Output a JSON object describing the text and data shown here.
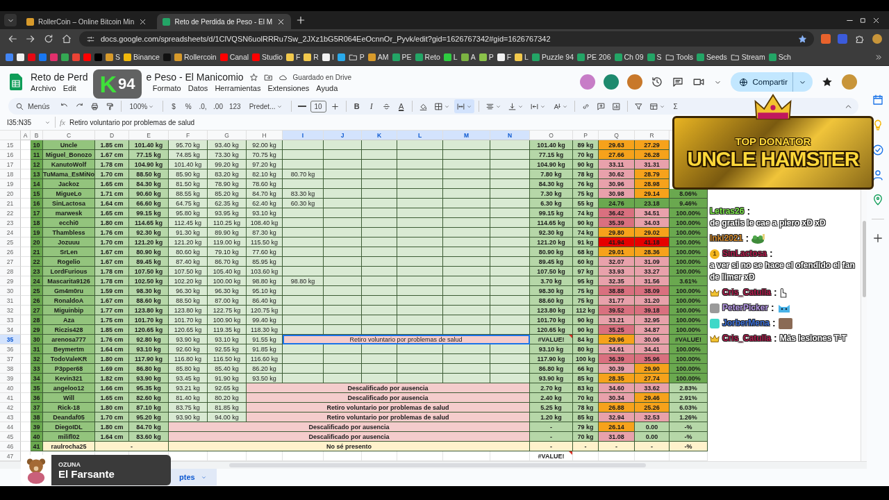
{
  "browser": {
    "tabs": [
      {
        "title": "RollerCoin – Online Bitcoin Min",
        "selected": false,
        "color": "#d79a2b"
      },
      {
        "title": "Reto de Perdida de Peso - El M",
        "selected": true,
        "color": "#23a566"
      }
    ],
    "url": "docs.google.com/spreadsheets/d/1ClVQSN6uolRRRu7Sw_2JXz1bG5R064EeOcnnOr_Pyvk/edit?gid=1626767342#gid=1626767342",
    "bookmarks": [
      {
        "kind": "site",
        "color": "#4285f4"
      },
      {
        "kind": "site",
        "color": "#f1f1f1"
      },
      {
        "kind": "site",
        "color": "#e50914"
      },
      {
        "kind": "site",
        "color": "#1877f2"
      },
      {
        "kind": "site",
        "color": "#e1306c"
      },
      {
        "kind": "site",
        "color": "#34a853"
      },
      {
        "kind": "site",
        "color": "#ea4335"
      },
      {
        "kind": "site",
        "color": "#ff0000"
      },
      {
        "kind": "site",
        "color": "#000000"
      },
      {
        "kind": "site",
        "label": "S",
        "color": "#d79a2b"
      },
      {
        "kind": "site",
        "label": "Binance",
        "color": "#f0b90b"
      },
      {
        "kind": "site",
        "color": "#111111"
      },
      {
        "kind": "site",
        "label": "Rollercoin",
        "color": "#d79a2b"
      },
      {
        "kind": "site",
        "label": "Canal",
        "color": "#ff0000"
      },
      {
        "kind": "site",
        "label": "Studio",
        "color": "#ff0000"
      },
      {
        "kind": "site",
        "label": "F",
        "color": "#f2c94c"
      },
      {
        "kind": "site",
        "label": "R",
        "color": "#f2c94c"
      },
      {
        "kind": "site",
        "label": "I",
        "color": "#f1f1f1"
      },
      {
        "kind": "site",
        "color": "#29a9eb"
      },
      {
        "kind": "folder",
        "label": "P"
      },
      {
        "kind": "site",
        "label": "AM",
        "color": "#d79a2b"
      },
      {
        "kind": "site",
        "label": "PE",
        "color": "#23a566"
      },
      {
        "kind": "site",
        "label": "Reto",
        "color": "#23a566"
      },
      {
        "kind": "site",
        "label": "L",
        "color": "#2ecc40"
      },
      {
        "kind": "site",
        "label": "A",
        "color": "#7cb342"
      },
      {
        "kind": "site",
        "label": "P",
        "color": "#8bc34a"
      },
      {
        "kind": "site",
        "label": "F",
        "color": "#f1f1f1"
      },
      {
        "kind": "site",
        "label": "L",
        "color": "#f2c94c"
      },
      {
        "kind": "site",
        "label": "Puzzle 94",
        "color": "#23a566"
      },
      {
        "kind": "site",
        "label": "PE 206",
        "color": "#23a566"
      },
      {
        "kind": "site",
        "label": "Ch 09",
        "color": "#23a566"
      },
      {
        "kind": "site",
        "label": "S",
        "color": "#23a566"
      },
      {
        "kind": "folder",
        "label": "Tools"
      },
      {
        "kind": "site",
        "label": "Seeds",
        "color": "#23a566"
      },
      {
        "kind": "folder",
        "label": "Stream"
      },
      {
        "kind": "site",
        "label": "Sch",
        "color": "#23a566"
      }
    ]
  },
  "doc": {
    "title_parts": [
      "Reto de Perd",
      "e Peso - El Manicomio"
    ],
    "save_status": "Guardado en Drive",
    "menus": [
      "Archivo",
      "Edit",
      "Formato",
      "Datos",
      "Herramientas",
      "Extensiones",
      "Ayuda"
    ],
    "share_label": "Compartir"
  },
  "toolbar": [
    {
      "kind": "search",
      "label": "Menús",
      "active": false
    },
    {
      "kind": "undo",
      "active": false
    },
    {
      "kind": "redo",
      "active": false
    },
    {
      "kind": "print",
      "active": false
    },
    {
      "kind": "paint",
      "active": false
    },
    {
      "kind": "zoom",
      "label": "100%",
      "active": false
    },
    {
      "kind": "text",
      "label": "$",
      "active": false
    },
    {
      "kind": "text",
      "label": "%",
      "active": false
    },
    {
      "kind": "text",
      "label": ".0,",
      "active": false
    },
    {
      "kind": "text",
      "label": ".00",
      "active": false
    },
    {
      "kind": "text",
      "label": "123",
      "active": false
    },
    {
      "kind": "select",
      "label": "Predet...",
      "active": false
    },
    {
      "kind": "minus",
      "active": false
    },
    {
      "kind": "field",
      "label": "10",
      "active": false
    },
    {
      "kind": "plus",
      "active": false
    },
    {
      "kind": "bold",
      "label": "B",
      "active": false
    },
    {
      "kind": "italic",
      "label": "I",
      "active": false
    },
    {
      "kind": "strike",
      "active": false
    },
    {
      "kind": "textcolor",
      "label": "A",
      "active": false
    },
    {
      "kind": "fill",
      "active": false
    },
    {
      "kind": "borders",
      "active": false
    },
    {
      "kind": "merge",
      "active": true
    },
    {
      "kind": "align",
      "active": false
    },
    {
      "kind": "valign",
      "active": false
    },
    {
      "kind": "wrap",
      "active": false
    },
    {
      "kind": "rotate",
      "active": false
    },
    {
      "kind": "link",
      "active": false
    },
    {
      "kind": "comment",
      "active": false
    },
    {
      "kind": "chart",
      "active": false
    },
    {
      "kind": "filter",
      "active": false
    },
    {
      "kind": "table",
      "active": false
    },
    {
      "kind": "text",
      "label": "Σ",
      "active": false
    }
  ],
  "formula_bar": {
    "range": "I35:N35",
    "fx": "fx",
    "content": "Retiro voluntario por problemas de salud"
  },
  "sheet": {
    "columns": [
      {
        "letter": "A",
        "selected": false
      },
      {
        "letter": "B",
        "selected": false
      },
      {
        "letter": "C",
        "selected": false
      },
      {
        "letter": "D",
        "selected": false
      },
      {
        "letter": "E",
        "selected": false
      },
      {
        "letter": "F",
        "selected": false
      },
      {
        "letter": "G",
        "selected": false
      },
      {
        "letter": "H",
        "selected": false
      },
      {
        "letter": "I",
        "selected": true
      },
      {
        "letter": "J",
        "selected": true
      },
      {
        "letter": "K",
        "selected": true
      },
      {
        "letter": "L",
        "selected": true
      },
      {
        "letter": "M",
        "selected": true
      },
      {
        "letter": "N",
        "selected": true
      },
      {
        "letter": "O",
        "selected": false
      },
      {
        "letter": "P",
        "selected": false
      },
      {
        "letter": "Q",
        "selected": false
      },
      {
        "letter": "R",
        "selected": false
      }
    ],
    "rows": [
      {
        "num": "15",
        "selected": false,
        "kind": "entry",
        "cells": {
          "B": "10",
          "C": "Uncle",
          "D": "1.85 cm",
          "E": "101.40 kg",
          "F": "95.70 kg",
          "G": "93.40 kg",
          "H": "92.00 kg",
          "O": "101.40 kg",
          "P": "89 kg",
          "Q": {
            "text": "29.63",
            "color": "#f6a21b"
          },
          "R": {
            "text": "27.29",
            "color": "#f6a21b"
          }
        }
      },
      {
        "num": "16",
        "selected": false,
        "kind": "entry",
        "cells": {
          "B": "11",
          "C": "Miguel_Bonozo",
          "D": "1.67 cm",
          "E": "77.15 kg",
          "F": "74.85 kg",
          "G": "73.30 kg",
          "H": "70.75 kg",
          "O": "77.15 kg",
          "P": "70 kg",
          "Q": {
            "text": "27.66",
            "color": "#f6a21b"
          },
          "R": {
            "text": "26.28",
            "color": "#f6a21b"
          }
        }
      },
      {
        "num": "17",
        "selected": false,
        "kind": "entry",
        "cells": {
          "B": "12",
          "C": "KanutoWolf",
          "D": "1.78 cm",
          "E": "104.90 kg",
          "F": "101.40 kg",
          "G": "99.20 kg",
          "H": "97.20 kg",
          "O": "104.90 kg",
          "P": "90 kg",
          "Q": {
            "text": "33.11",
            "color": "#e8a1ab"
          },
          "R": {
            "text": "31.31",
            "color": "#e8a1ab"
          }
        }
      },
      {
        "num": "18",
        "selected": false,
        "kind": "entry",
        "cells": {
          "B": "13",
          "C": "TuMama_EsMiNo",
          "D": "1.70 cm",
          "E": "88.50 kg",
          "F": "85.90 kg",
          "G": "83.20 kg",
          "H": "82.10 kg",
          "I": "80.70 kg",
          "O": "7.80 kg",
          "P": "78 kg",
          "Q": {
            "text": "30.62",
            "color": "#e8a1ab"
          },
          "R": {
            "text": "28.79",
            "color": "#f6a21b"
          }
        }
      },
      {
        "num": "19",
        "selected": false,
        "kind": "entry",
        "cells": {
          "B": "14",
          "C": "Jackoz",
          "D": "1.65 cm",
          "E": "84.30 kg",
          "F": "81.50 kg",
          "G": "78.90 kg",
          "H": "78.60 kg",
          "O": "84.30 kg",
          "P": "76 kg",
          "Q": {
            "text": "30.96",
            "color": "#e8a1ab"
          },
          "R": {
            "text": "28.98",
            "color": "#f6a21b"
          }
        }
      },
      {
        "num": "20",
        "selected": false,
        "kind": "entry",
        "cells": {
          "B": "15",
          "C": "MigueLo",
          "D": "1.71 cm",
          "E": "90.60 kg",
          "F": "88.55 kg",
          "G": "85.20 kg",
          "H": "84.70 kg",
          "I": "83.30 kg",
          "O": "7.30 kg",
          "P": "75 kg",
          "Q": {
            "text": "30.98",
            "color": "#e8a1ab"
          },
          "R": {
            "text": "29.14",
            "color": "#f6a21b"
          },
          "S": {
            "text": "8.06%",
            "color": "#6aa84f"
          }
        }
      },
      {
        "num": "21",
        "selected": false,
        "kind": "entry",
        "cells": {
          "B": "16",
          "C": "SinLactosa",
          "D": "1.64 cm",
          "E": "66.60 kg",
          "F": "64.75 kg",
          "G": "62.35 kg",
          "H": "62.40 kg",
          "I": "60.30 kg",
          "O": "6.30 kg",
          "P": "55 kg",
          "Q": {
            "text": "24.76",
            "color": "#6aa84f"
          },
          "R": {
            "text": "23.18",
            "color": "#6aa84f"
          },
          "S": {
            "text": "9.46%",
            "color": "#6aa84f"
          }
        }
      },
      {
        "num": "22",
        "selected": false,
        "kind": "entry",
        "cells": {
          "B": "17",
          "C": "marwesk",
          "D": "1.65 cm",
          "E": "99.15 kg",
          "F": "95.80 kg",
          "G": "93.95 kg",
          "H": "93.10 kg",
          "O": "99.15 kg",
          "P": "74 kg",
          "Q": {
            "text": "36.42",
            "color": "#d9707f"
          },
          "R": {
            "text": "34.51",
            "color": "#e8a1ab"
          },
          "S": {
            "text": "100.00%",
            "color": "#6aa84f"
          }
        }
      },
      {
        "num": "23",
        "selected": false,
        "kind": "entry",
        "cells": {
          "B": "18",
          "C": "ecchi0",
          "D": "1.80 cm",
          "E": "114.65 kg",
          "F": "112.45 kg",
          "G": "110.25 kg",
          "H": "108.40 kg",
          "O": "114.65 kg",
          "P": "90 kg",
          "Q": {
            "text": "35.39",
            "color": "#d9707f"
          },
          "R": {
            "text": "34.03",
            "color": "#e8a1ab"
          },
          "S": {
            "text": "100.00%",
            "color": "#6aa84f"
          }
        }
      },
      {
        "num": "24",
        "selected": false,
        "kind": "entry",
        "cells": {
          "B": "19",
          "C": "Thambless",
          "D": "1.76 cm",
          "E": "92.30 kg",
          "F": "91.30 kg",
          "G": "89.90 kg",
          "H": "87.30 kg",
          "O": "92.30 kg",
          "P": "74 kg",
          "Q": {
            "text": "29.80",
            "color": "#f6a21b"
          },
          "R": {
            "text": "29.02",
            "color": "#f6a21b"
          },
          "S": {
            "text": "100.00%",
            "color": "#6aa84f"
          }
        }
      },
      {
        "num": "25",
        "selected": false,
        "kind": "entry",
        "cells": {
          "B": "20",
          "C": "Jozuuu",
          "D": "1.70 cm",
          "E": "121.20 kg",
          "F": "121.20 kg",
          "G": "119.00 kg",
          "H": "115.50 kg",
          "O": "121.20 kg",
          "P": "91 kg",
          "Q": {
            "text": "41.94",
            "color": "#e50000"
          },
          "R": {
            "text": "41.18",
            "color": "#e50000"
          },
          "S": {
            "text": "100.00%",
            "color": "#6aa84f"
          }
        }
      },
      {
        "num": "26",
        "selected": false,
        "kind": "entry",
        "cells": {
          "B": "21",
          "C": "SrLen",
          "D": "1.67 cm",
          "E": "80.90 kg",
          "F": "80.60 kg",
          "G": "79.10 kg",
          "H": "77.60 kg",
          "O": "80.90 kg",
          "P": "68 kg",
          "Q": {
            "text": "29.01",
            "color": "#f6a21b"
          },
          "R": {
            "text": "28.36",
            "color": "#f6a21b"
          },
          "S": {
            "text": "100.00%",
            "color": "#6aa84f"
          }
        }
      },
      {
        "num": "27",
        "selected": false,
        "kind": "entry",
        "cells": {
          "B": "22",
          "C": "Rogelio",
          "D": "1.67 cm",
          "E": "89.45 kg",
          "F": "87.40 kg",
          "G": "86.70 kg",
          "H": "85.95 kg",
          "O": "89.45 kg",
          "P": "60 kg",
          "Q": {
            "text": "32.07",
            "color": "#e8a1ab"
          },
          "R": {
            "text": "31.09",
            "color": "#e8a1ab"
          },
          "S": {
            "text": "100.00%",
            "color": "#6aa84f"
          }
        }
      },
      {
        "num": "28",
        "selected": false,
        "kind": "entry",
        "cells": {
          "B": "23",
          "C": "LordFurious",
          "D": "1.78 cm",
          "E": "107.50 kg",
          "F": "107.50 kg",
          "G": "105.40 kg",
          "H": "103.60 kg",
          "O": "107.50 kg",
          "P": "97 kg",
          "Q": {
            "text": "33.93",
            "color": "#e8a1ab"
          },
          "R": {
            "text": "33.27",
            "color": "#e8a1ab"
          },
          "S": {
            "text": "100.00%",
            "color": "#6aa84f"
          }
        }
      },
      {
        "num": "29",
        "selected": false,
        "kind": "entry",
        "cells": {
          "B": "24",
          "C": "Mascarita9126",
          "D": "1.78 cm",
          "E": "102.50 kg",
          "F": "102.20 kg",
          "G": "100.00 kg",
          "H": "98.80 kg",
          "I": "98.80 kg",
          "O": "3.70 kg",
          "P": "95 kg",
          "Q": {
            "text": "32.35",
            "color": "#e8a1ab"
          },
          "R": {
            "text": "31.56",
            "color": "#e8a1ab"
          },
          "S": {
            "text": "3.61%",
            "color": "#6aa84f"
          }
        }
      },
      {
        "num": "30",
        "selected": false,
        "kind": "entry",
        "cells": {
          "B": "25",
          "C": "Gm4m0ru",
          "D": "1.59 cm",
          "E": "98.30 kg",
          "F": "96.30 kg",
          "G": "96.30 kg",
          "H": "95.10 kg",
          "O": "98.30 kg",
          "P": "75 kg",
          "Q": {
            "text": "38.88",
            "color": "#d9707f"
          },
          "R": {
            "text": "38.09",
            "color": "#d9707f"
          },
          "S": {
            "text": "100.00%",
            "color": "#6aa84f"
          }
        }
      },
      {
        "num": "31",
        "selected": false,
        "kind": "entry",
        "cells": {
          "B": "26",
          "C": "RonaldoA",
          "D": "1.67 cm",
          "E": "88.60 kg",
          "F": "88.50 kg",
          "G": "87.00 kg",
          "H": "86.40 kg",
          "O": "88.60 kg",
          "P": "75 kg",
          "Q": {
            "text": "31.77",
            "color": "#e8a1ab"
          },
          "R": {
            "text": "31.20",
            "color": "#e8a1ab"
          },
          "S": {
            "text": "100.00%",
            "color": "#6aa84f"
          }
        }
      },
      {
        "num": "32",
        "selected": false,
        "kind": "entry",
        "cells": {
          "B": "27",
          "C": "Miguinbip",
          "D": "1.77 cm",
          "E": "123.80 kg",
          "F": "123.80 kg",
          "G": "122.75 kg",
          "H": "120.75 kg",
          "O": "123.80 kg",
          "P": "112 kg",
          "Q": {
            "text": "39.52",
            "color": "#d9707f"
          },
          "R": {
            "text": "39.18",
            "color": "#d9707f"
          },
          "S": {
            "text": "100.00%",
            "color": "#6aa84f"
          }
        }
      },
      {
        "num": "33",
        "selected": false,
        "kind": "entry",
        "cells": {
          "B": "28",
          "C": "Aza",
          "D": "1.75 cm",
          "E": "101.70 kg",
          "F": "101.70 kg",
          "G": "100.90 kg",
          "H": "99.40 kg",
          "O": "101.70 kg",
          "P": "90 kg",
          "Q": {
            "text": "33.21",
            "color": "#e8a1ab"
          },
          "R": {
            "text": "32.95",
            "color": "#e8a1ab"
          },
          "S": {
            "text": "100.00%",
            "color": "#6aa84f"
          }
        }
      },
      {
        "num": "34",
        "selected": false,
        "kind": "entry",
        "cells": {
          "B": "29",
          "C": "Riczis428",
          "D": "1.85 cm",
          "E": "120.65 kg",
          "F": "120.65 kg",
          "G": "119.35 kg",
          "H": "118.30 kg",
          "O": "120.65 kg",
          "P": "90 kg",
          "Q": {
            "text": "35.25",
            "color": "#d9707f"
          },
          "R": {
            "text": "34.87",
            "color": "#e8a1ab"
          },
          "S": {
            "text": "100.00%",
            "color": "#6aa84f"
          }
        }
      },
      {
        "num": "35",
        "selected": true,
        "kind": "entry",
        "cells": {
          "B": "30",
          "C": "arenosa777",
          "D": "1.76 cm",
          "E": "92.80 kg",
          "F": "93.90 kg",
          "G": "93.10 kg",
          "H": "91.55 kg",
          "I": {
            "kind": "remark",
            "text": "Retiro voluntario por problemas de salud",
            "selected": true
          },
          "O": {
            "text": "#VALUE!",
            "flag": true
          },
          "P": "84 kg",
          "Q": {
            "text": "29.96",
            "color": "#f6a21b"
          },
          "R": {
            "text": "30.06",
            "color": "#e8a1ab"
          },
          "S": {
            "text": "#VALUE!",
            "color": "#6aa84f"
          }
        }
      },
      {
        "num": "36",
        "selected": false,
        "kind": "entry",
        "cells": {
          "B": "31",
          "C": "Beymertm",
          "D": "1.64 cm",
          "E": "93.10 kg",
          "F": "92.60 kg",
          "G": "92.55 kg",
          "H": "91.85 kg",
          "O": "93.10 kg",
          "P": "80 kg",
          "Q": {
            "text": "34.61",
            "color": "#e8a1ab"
          },
          "R": {
            "text": "34.41",
            "color": "#e8a1ab"
          },
          "S": {
            "text": "100.00%",
            "color": "#6aa84f"
          }
        }
      },
      {
        "num": "37",
        "selected": false,
        "kind": "entry",
        "cells": {
          "B": "32",
          "C": "TodoValeKR",
          "D": "1.80 cm",
          "E": "117.90 kg",
          "F": "116.80 kg",
          "G": "116.50 kg",
          "H": "116.60 kg",
          "O": "117.90 kg",
          "P": "100 kg",
          "Q": {
            "text": "36.39",
            "color": "#d9707f"
          },
          "R": {
            "text": "35.96",
            "color": "#d9707f"
          },
          "S": {
            "text": "100.00%",
            "color": "#6aa84f"
          }
        }
      },
      {
        "num": "38",
        "selected": false,
        "kind": "entry",
        "cells": {
          "B": "33",
          "C": "P3pper68",
          "D": "1.69 cm",
          "E": "86.80 kg",
          "F": "85.80 kg",
          "G": "85.40 kg",
          "H": "86.20 kg",
          "O": "86.80 kg",
          "P": "66 kg",
          "Q": {
            "text": "30.39",
            "color": "#e8a1ab"
          },
          "R": {
            "text": "29.90",
            "color": "#f6a21b"
          },
          "S": {
            "text": "100.00%",
            "color": "#6aa84f"
          }
        }
      },
      {
        "num": "39",
        "selected": false,
        "kind": "entry",
        "cells": {
          "B": "34",
          "C": "Kevin321",
          "D": "1.82 cm",
          "E": "93.90 kg",
          "F": "93.45 kg",
          "G": "91.90 kg",
          "H": "93.50 kg",
          "O": "93.90 kg",
          "P": "85 kg",
          "Q": {
            "text": "28.35",
            "color": "#f6a21b"
          },
          "R": {
            "text": "27.74",
            "color": "#f6a21b"
          },
          "S": {
            "text": "100.00%",
            "color": "#6aa84f"
          }
        }
      },
      {
        "num": "40",
        "selected": false,
        "kind": "entry",
        "cells": {
          "B": "35",
          "C": "angeloo12",
          "D": "1.66 cm",
          "E": "95.35 kg",
          "F": "93.21 kg",
          "G": "92.65 kg",
          "H": {
            "kind": "note",
            "text": "Descalificado por ausencia",
            "selected": false
          },
          "O": "2.70 kg",
          "P": "83 kg",
          "Q": {
            "text": "34.60",
            "color": "#e8a1ab"
          },
          "R": {
            "text": "33.62",
            "color": "#e8a1ab"
          },
          "S": {
            "text": "2.83%",
            "color": "#b6d7a8"
          }
        }
      },
      {
        "num": "41",
        "selected": false,
        "kind": "entry",
        "cells": {
          "B": "36",
          "C": "Will",
          "D": "1.65 cm",
          "E": "82.60 kg",
          "F": "81.40 kg",
          "G": "80.20 kg",
          "H": {
            "kind": "note",
            "text": "Descalificado por ausencia",
            "selected": false
          },
          "O": "2.40 kg",
          "P": "70 kg",
          "Q": {
            "text": "30.34",
            "color": "#e8a1ab"
          },
          "R": {
            "text": "29.46",
            "color": "#f6a21b"
          },
          "S": {
            "text": "2.91%",
            "color": "#b6d7a8"
          }
        }
      },
      {
        "num": "42",
        "selected": false,
        "kind": "entry",
        "cells": {
          "B": "37",
          "C": "Rick-18",
          "D": "1.80 cm",
          "E": "87.10 kg",
          "F": "83.75 kg",
          "G": "81.85 kg",
          "H": {
            "kind": "note",
            "text": "Retiro voluntario por problemas de salud",
            "selected": false
          },
          "O": "5.25 kg",
          "P": "78 kg",
          "Q": {
            "text": "26.88",
            "color": "#f6a21b"
          },
          "R": {
            "text": "25.26",
            "color": "#f6a21b"
          },
          "S": {
            "text": "6.03%",
            "color": "#b6d7a8"
          }
        }
      },
      {
        "num": "43",
        "selected": false,
        "kind": "entry",
        "cells": {
          "B": "38",
          "C": "Deandaf05",
          "D": "1.70 cm",
          "E": "95.20 kg",
          "F": "93.90 kg",
          "G": "94.00 kg",
          "H": {
            "kind": "note",
            "text": "Retiro voluntario por problemas de salud",
            "selected": false
          },
          "O": "1.20 kg",
          "P": "85 kg",
          "Q": {
            "text": "32.94",
            "color": "#e8a1ab"
          },
          "R": {
            "text": "32.53",
            "color": "#e8a1ab"
          },
          "S": {
            "text": "1.26%",
            "color": "#b6d7a8"
          }
        }
      },
      {
        "num": "44",
        "selected": false,
        "kind": "entry",
        "cells": {
          "B": "39",
          "C": "DiegoIDL",
          "D": "1.80 cm",
          "E": "84.70 kg",
          "F": {
            "kind": "note",
            "text": "Descalificado por ausencia",
            "selected": false
          },
          "O": "-",
          "P": "79 kg",
          "Q": {
            "text": "26.14",
            "color": "#f6a21b"
          },
          "R": {
            "text": "0.00",
            "color": "#b6d7a8"
          },
          "S": {
            "text": "-%",
            "color": "#b6d7a8"
          }
        }
      },
      {
        "num": "45",
        "selected": false,
        "kind": "entry",
        "cells": {
          "B": "40",
          "C": "milifl02",
          "D": "1.64 cm",
          "E": "83.60 kg",
          "F": {
            "kind": "note",
            "text": "Descalificado por ausencia",
            "selected": false
          },
          "O": "-",
          "P": "70 kg",
          "Q": {
            "text": "31.08",
            "color": "#e8a1ab"
          },
          "R": {
            "text": "0.00",
            "color": "#b6d7a8"
          },
          "S": {
            "text": "-%",
            "color": "#b6d7a8"
          }
        }
      },
      {
        "num": "46",
        "selected": false,
        "kind": "pending",
        "cells": {
          "B": "41",
          "C": "raulrocha25",
          "D": {
            "kind": "pending",
            "text": "-",
            "selected": false
          },
          "F": {
            "kind": "pending",
            "text": "No sé presento",
            "selected": false
          },
          "O": "-",
          "P": "-",
          "Q": "-",
          "R": "-",
          "S": "-%"
        }
      },
      {
        "num": "47",
        "selected": false,
        "kind": "blank",
        "cells": {
          "O": {
            "text": "#VALUE!",
            "flag": true
          }
        }
      }
    ],
    "sheet_tab": "ptes"
  },
  "overlays": {
    "logo": {
      "letter": "K",
      "number": "94"
    },
    "donator": {
      "label": "TOP DONATOR",
      "name": "UNCLE HAMSTER"
    },
    "chat": [
      {
        "user": "Letras26",
        "color": "#7ce84a",
        "separator": ":",
        "text": "de gratis le cae a piero xD xD"
      },
      {
        "user": "lnki2021",
        "color": "#d4892a",
        "separator": ":",
        "emote": {
          "kind": "frog"
        }
      },
      {
        "user": "SinLactosa",
        "color": "#b0184a",
        "badge": {
          "kind": "coin",
          "label": "1"
        },
        "separator": ":",
        "text": "a ver si no se hace el ofendido el fan de limer xD"
      },
      {
        "user": "Cris_Catulla",
        "color": "#b0184a",
        "badge": {
          "kind": "crown"
        },
        "separator": ":",
        "emote": {
          "kind": "hand"
        }
      },
      {
        "user": "PeterPicker",
        "color": "#b89ae8",
        "badge": {
          "kind": "grey"
        },
        "separator": ":",
        "emote": {
          "kind": "cat"
        }
      },
      {
        "user": "JorberMena",
        "color": "#3a6fd8",
        "badge": {
          "kind": "teal"
        },
        "separator": ":",
        "emote": {
          "kind": "photo"
        }
      },
      {
        "user": "Cris_Catulla",
        "color": "#b0184a",
        "badge": {
          "kind": "crown"
        },
        "separator": ":",
        "text": "Más lesiones T-T"
      }
    ],
    "music": {
      "artist": "OZUNA",
      "title": "El Farsante"
    }
  }
}
